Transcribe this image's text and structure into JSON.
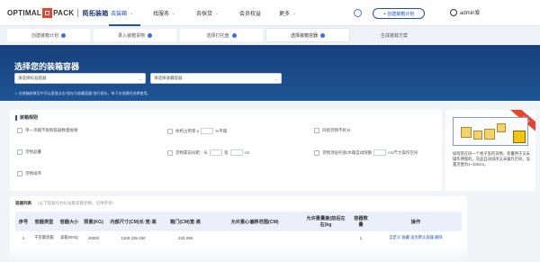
{
  "brand": {
    "logo_left": "OPTIMAL",
    "logo_right": "PACK",
    "name_cn": "简拓装箱"
  },
  "nav": [
    {
      "label": "去装箱",
      "active": true,
      "has_chevron": true
    },
    {
      "label": "找服务",
      "active": false,
      "has_chevron": true
    },
    {
      "label": "去採货",
      "active": false,
      "has_chevron": true
    },
    {
      "label": "会员权益",
      "active": false,
      "has_chevron": false
    },
    {
      "label": "更多",
      "active": false,
      "has_chevron": true
    }
  ],
  "header": {
    "new_plan_button": "+ 创建装箱计划",
    "user": "admin爱"
  },
  "steps": [
    {
      "label": "创建装箱计划",
      "state": "done"
    },
    {
      "label": "录入装箱货物",
      "state": "done"
    },
    {
      "label": "选择打托盘",
      "state": "done"
    },
    {
      "label": "选择装箱容器",
      "state": "current"
    },
    {
      "label": "生成装载方案",
      "state": "next"
    }
  ],
  "hero": {
    "title": "选择您的装箱容器",
    "select1_placeholder": "请选择标准容器",
    "select2_placeholder": "请选择收藏容器",
    "hint": "☆ 在装箱结果页中可以直接点击“保存为收藏容器”进行保存，待下次创建时选择使用。"
  },
  "rules": {
    "title": "装箱规则",
    "r1": "单一货箱不限制容器数量规格",
    "r2": "体积占用率 ≥",
    "r2_unit": "%平铺",
    "r3": "同组货物不拆分",
    "r4": "货物品叠",
    "r5": "货物靠前间距：长",
    "r5_w": "宽",
    "r5_h": "cm",
    "r6": "货物顶层托盘/木箱自动限额",
    "r6_tail": "cm尺寸操作空间",
    "r7": "货物排序"
  },
  "side": {
    "ribbon": "NEW",
    "desc": "如何装在同一个柜子里的货物，装量用于又未操作弹窗的，货品自动排序又未操作空间，设置范围为1~100cm。"
  },
  "table": {
    "title": "容器列表",
    "subtitle": "（以下容器均为标准集装箱参数，仅供参考）",
    "headers": [
      "序号",
      "容器类型",
      "容器大小",
      "限重(KG)",
      "内部尺寸(CM)长·宽·高",
      "箱门(CM)宽·高",
      "允许重心偏移范围(CM)",
      "允许重量差(前后左右)kg",
      "容器数量",
      "操作"
    ],
    "rows": [
      [
        "1",
        "干货集装箱",
        "高箱40HQ",
        "26000",
        "1200·235·250",
        "233·258",
        "",
        "",
        "1",
        "自定义  收藏  设为默认容器  删除"
      ]
    ]
  }
}
